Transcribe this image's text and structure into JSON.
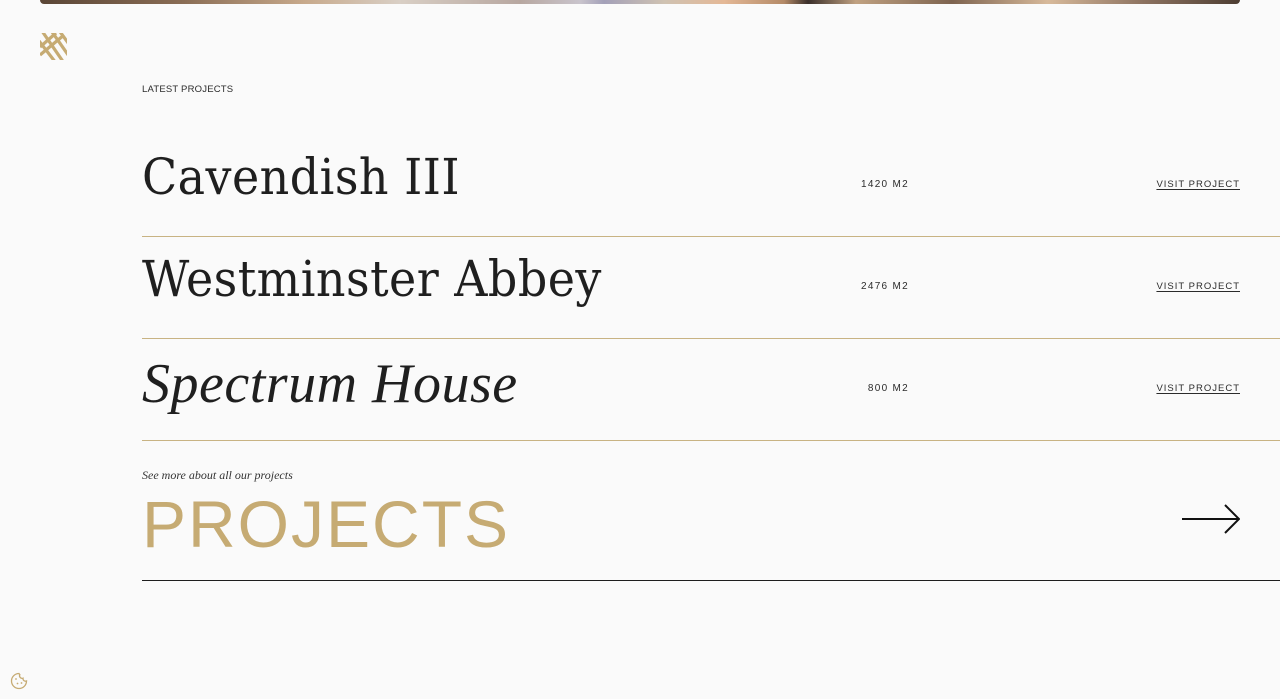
{
  "colors": {
    "background": "#fafafa",
    "accent_gold": "#c6ab73",
    "divider_gold": "#c8b383",
    "text_dark": "#1f1f1f"
  },
  "icons": {
    "logo": "diagonal-stripes-logo-icon",
    "arrow": "arrow-right-icon",
    "cookie": "cookie-icon"
  },
  "section": {
    "label": "LATEST PROJECTS"
  },
  "projects": [
    {
      "name": "Cavendish III",
      "area": "1420 M2",
      "link": "VISIT PROJECT",
      "italic": false
    },
    {
      "name": "Westminster Abbey",
      "area": "2476 M2",
      "link": "VISIT PROJECT",
      "italic": false
    },
    {
      "name": "Spectrum House",
      "area": "800 M2",
      "link": "VISIT PROJECT",
      "italic": true
    }
  ],
  "more": {
    "caption": "See more about all our projects",
    "title": "PROJECTS"
  }
}
